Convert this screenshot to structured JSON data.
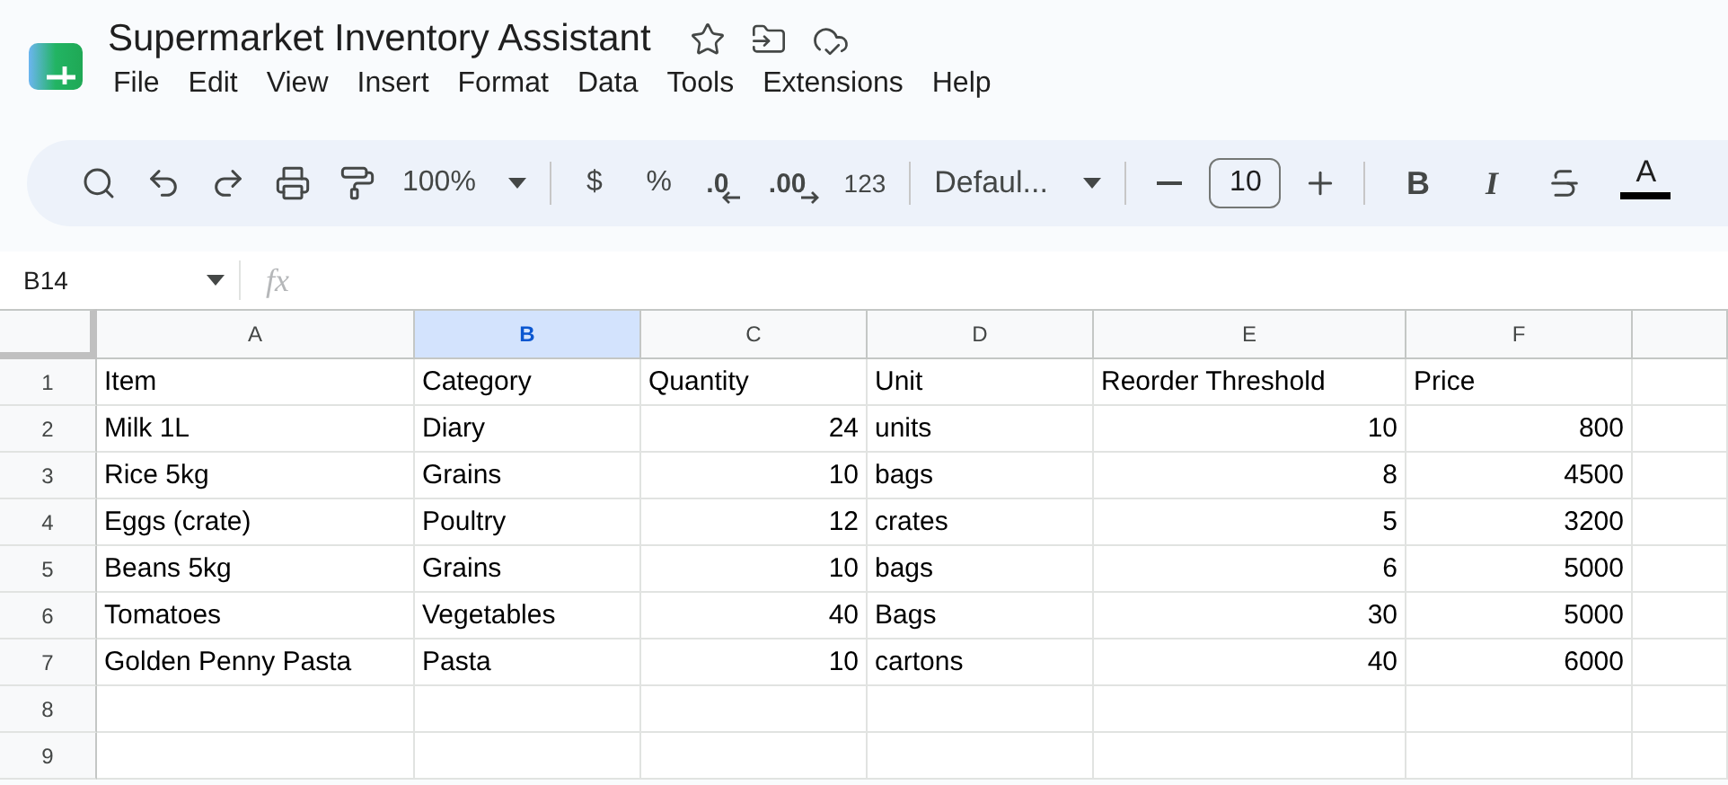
{
  "document": {
    "title": "Supermarket Inventory Assistant"
  },
  "menu": [
    "File",
    "Edit",
    "View",
    "Insert",
    "Format",
    "Data",
    "Tools",
    "Extensions",
    "Help"
  ],
  "toolbar": {
    "zoom": "100%",
    "currency": "$",
    "percent": "%",
    "decrease_decimals": ".0",
    "increase_decimals": ".00",
    "number_format": "123",
    "font": "Defaul...",
    "font_size": "10",
    "bold": "B",
    "italic": "I",
    "text_color": {
      "label": "A",
      "color": "#000000"
    }
  },
  "formula_bar": {
    "cell_reference": "B14",
    "fx": "fx"
  },
  "columns": [
    {
      "label": "A",
      "selected": false
    },
    {
      "label": "B",
      "selected": true
    },
    {
      "label": "C",
      "selected": false
    },
    {
      "label": "D",
      "selected": false
    },
    {
      "label": "E",
      "selected": false
    },
    {
      "label": "F",
      "selected": false
    }
  ],
  "rows": [
    {
      "number": "1",
      "cells": [
        "Item",
        "Category",
        "Quantity",
        "Unit",
        "Reorder Threshold",
        "Price"
      ]
    },
    {
      "number": "2",
      "cells": [
        "Milk 1L",
        "Diary",
        "24",
        "units",
        "10",
        "800"
      ]
    },
    {
      "number": "3",
      "cells": [
        "Rice 5kg",
        "Grains",
        "10",
        "bags",
        "8",
        "4500"
      ]
    },
    {
      "number": "4",
      "cells": [
        "Eggs (crate)",
        "Poultry",
        "12",
        "crates",
        "5",
        "3200"
      ]
    },
    {
      "number": "5",
      "cells": [
        "Beans 5kg",
        "Grains",
        "10",
        "bags",
        "6",
        "5000"
      ]
    },
    {
      "number": "6",
      "cells": [
        "Tomatoes",
        "Vegetables",
        "40",
        "Bags",
        "30",
        "5000"
      ]
    },
    {
      "number": "7",
      "cells": [
        "Golden Penny Pasta",
        "Pasta",
        "10",
        "cartons",
        "40",
        "6000"
      ]
    },
    {
      "number": "8",
      "cells": []
    },
    {
      "number": "9",
      "cells": []
    }
  ]
}
